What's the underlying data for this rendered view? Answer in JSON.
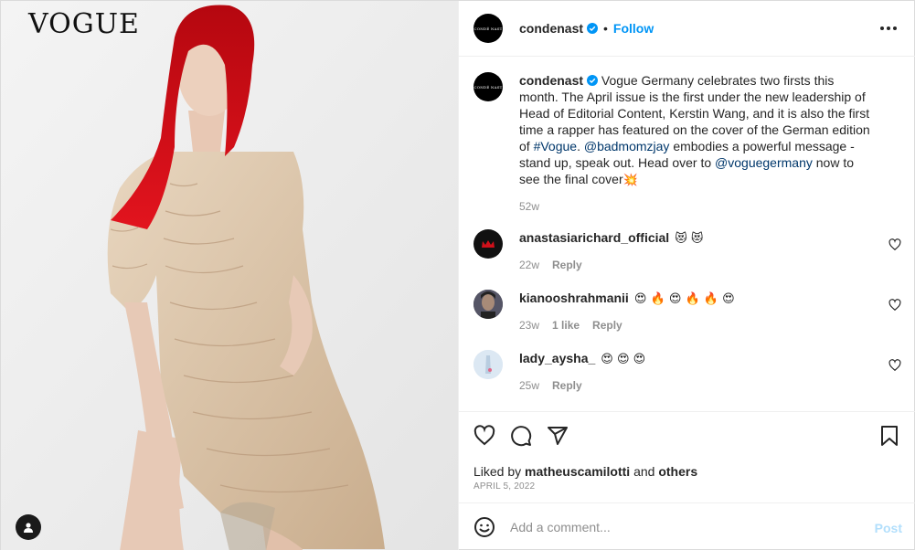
{
  "post": {
    "brand_logo": "VOGUE",
    "account": {
      "username": "condenast",
      "avatar_text": "CONDÉ NAST",
      "verified": true,
      "follow_label": "Follow",
      "separator": "•"
    },
    "caption": {
      "username": "condenast",
      "text_1": " Vogue Germany celebrates two firsts this month. The April issue is the first under the new leadership of Head of Editorial Content, Kerstin Wang, and it is also the first time a rapper has featured on the cover of the German edition of ",
      "hashtag": "#Vogue",
      "text_2": ". ",
      "mention_1": "@badmomzjay",
      "text_3": " embodies a powerful message - stand up, speak out. Head over to ",
      "mention_2": "@voguegermany",
      "text_4": " now to see the final cover",
      "emoji": "💥",
      "time": "52w"
    },
    "comments": [
      {
        "username": "anastasiarichard_official",
        "text": "😻 😻",
        "time": "22w",
        "likes": "",
        "reply": "Reply"
      },
      {
        "username": "kianooshrahmanii",
        "text": "😍 🔥 😍 🔥 🔥 😍",
        "time": "23w",
        "likes": "1 like",
        "reply": "Reply"
      },
      {
        "username": "lady_aysha_",
        "text": "😍 😍 😍",
        "time": "25w",
        "likes": "",
        "reply": "Reply"
      }
    ],
    "liked_by": {
      "prefix": "Liked by ",
      "user": "matheuscamilotti",
      "middle": " and ",
      "others": "others"
    },
    "date": "APRIL 5, 2022",
    "add_comment": {
      "placeholder": "Add a comment...",
      "post_label": "Post"
    },
    "icons": [
      "heart-icon",
      "comment-icon",
      "share-icon",
      "bookmark-icon",
      "emoji-icon",
      "more-icon",
      "user-tag-icon",
      "verified-icon"
    ],
    "colors": {
      "accent": "#0095f6",
      "link": "#00376b",
      "muted": "#8e8e8e",
      "post_disabled": "#b2dffc",
      "hair": "#d0101a"
    }
  }
}
